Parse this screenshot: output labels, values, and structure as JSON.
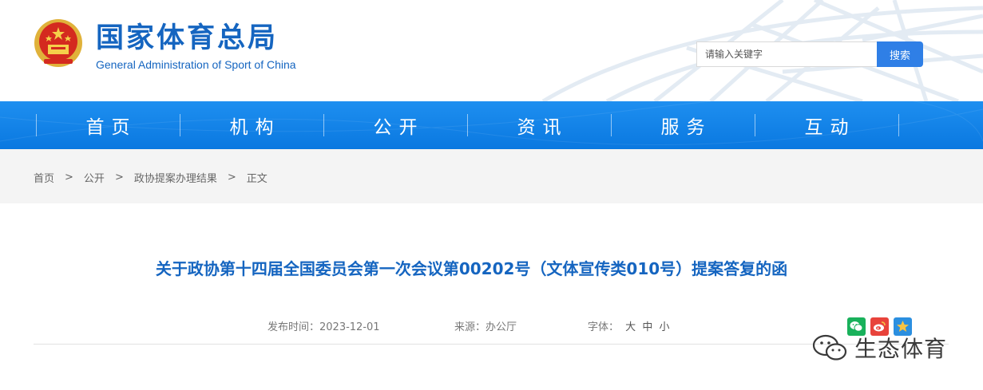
{
  "header": {
    "title": "国家体育总局",
    "subtitle": "General Administration of Sport of China",
    "search_placeholder": "请输入关键字",
    "search_button": "搜索"
  },
  "nav": {
    "items": [
      "首页",
      "机构",
      "公开",
      "资讯",
      "服务",
      "互动"
    ]
  },
  "breadcrumb": {
    "items": [
      "首页",
      "公开",
      "政协提案办理结果",
      "正文"
    ],
    "separator": ">"
  },
  "article": {
    "title": "关于政协第十四届全国委员会第一次会议第00202号（文体宣传类010号）提案答复的函",
    "date_label": "发布时间：",
    "date": "2023-12-01",
    "source_label": "来源：",
    "source": "办公厅",
    "font_label": "字体：",
    "font_options": [
      "大",
      "中",
      "小"
    ]
  },
  "share": {
    "icons": [
      "wechat-icon",
      "weibo-icon",
      "qzone-icon"
    ]
  },
  "watermark": {
    "text": "生态体育",
    "icon": "wechat-official-account-icon"
  },
  "colors": {
    "brand_blue": "#1565c0",
    "nav_blue": "#0a78e0",
    "search_button": "#2f7fe6",
    "breadcrumb_bg": "#f4f4f4"
  }
}
